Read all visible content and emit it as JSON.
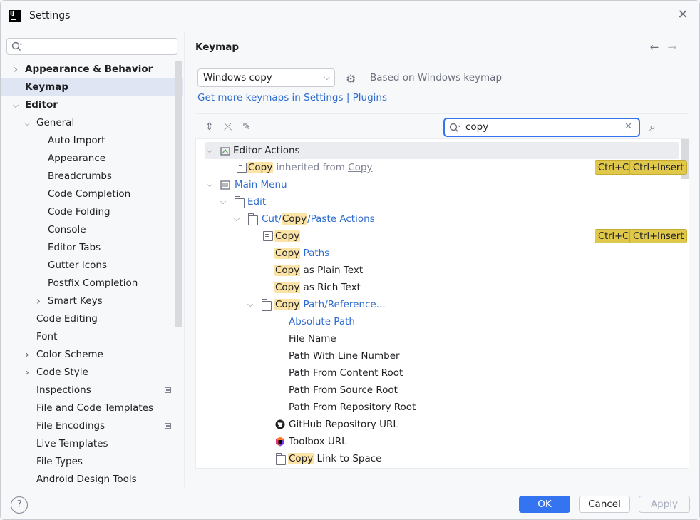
{
  "window": {
    "title": "Settings",
    "logo": "IJ"
  },
  "sidebar": {
    "search_placeholder": "",
    "items": [
      {
        "label": "Appearance & Behavior",
        "level": 0,
        "chevron": "right",
        "bold": true
      },
      {
        "label": "Keymap",
        "level": 0,
        "chevron": "",
        "bold": true,
        "selected": true
      },
      {
        "label": "Editor",
        "level": 0,
        "chevron": "down",
        "bold": true
      },
      {
        "label": "General",
        "level": 1,
        "chevron": "down"
      },
      {
        "label": "Auto Import",
        "level": 2
      },
      {
        "label": "Appearance",
        "level": 2
      },
      {
        "label": "Breadcrumbs",
        "level": 2
      },
      {
        "label": "Code Completion",
        "level": 2
      },
      {
        "label": "Code Folding",
        "level": 2
      },
      {
        "label": "Console",
        "level": 2
      },
      {
        "label": "Editor Tabs",
        "level": 2
      },
      {
        "label": "Gutter Icons",
        "level": 2
      },
      {
        "label": "Postfix Completion",
        "level": 2
      },
      {
        "label": "Smart Keys",
        "level": 2,
        "chevron": "right"
      },
      {
        "label": "Code Editing",
        "level": 1
      },
      {
        "label": "Font",
        "level": 1
      },
      {
        "label": "Color Scheme",
        "level": 1,
        "chevron": "right"
      },
      {
        "label": "Code Style",
        "level": 1,
        "chevron": "right"
      },
      {
        "label": "Inspections",
        "level": 1,
        "pin": true
      },
      {
        "label": "File and Code Templates",
        "level": 1
      },
      {
        "label": "File Encodings",
        "level": 1,
        "pin": true
      },
      {
        "label": "Live Templates",
        "level": 1
      },
      {
        "label": "File Types",
        "level": 1
      },
      {
        "label": "Android Design Tools",
        "level": 1
      }
    ]
  },
  "main": {
    "title": "Keymap",
    "keymap_select": "Windows copy",
    "based_on": "Based on Windows keymap",
    "more_link": "Get more keymaps in Settings | Plugins",
    "filter_value": "copy",
    "tree": {
      "editor_actions": "Editor Actions",
      "copy": "Copy",
      "inherited_from": "inherited from",
      "main_menu": "Main Menu",
      "edit": "Edit",
      "cut": "Cut/",
      "paste_actions": "/Paste Actions",
      "paths": "Paths",
      "as_plain": "as Plain Text",
      "as_rich": "as Rich Text",
      "path_ref": "Path/Reference...",
      "absolute_path": "Absolute Path",
      "file_name": "File Name",
      "path_line": "Path With Line Number",
      "path_content": "Path From Content Root",
      "path_source": "Path From Source Root",
      "path_repo": "Path From Repository Root",
      "github_url": "GitHub Repository URL",
      "toolbox_url": "Toolbox URL",
      "link_space": "Link to Space"
    },
    "shortcuts": {
      "ctrl_c": "Ctrl+C",
      "ctrl_insert": "Ctrl+Insert"
    }
  },
  "footer": {
    "help": "?",
    "ok": "OK",
    "cancel": "Cancel",
    "apply": "Apply"
  },
  "colors": {
    "accent": "#3574f0",
    "link": "#2e6ccf",
    "highlight": "#fbe4a6",
    "shortcut": "#e0c94a"
  }
}
